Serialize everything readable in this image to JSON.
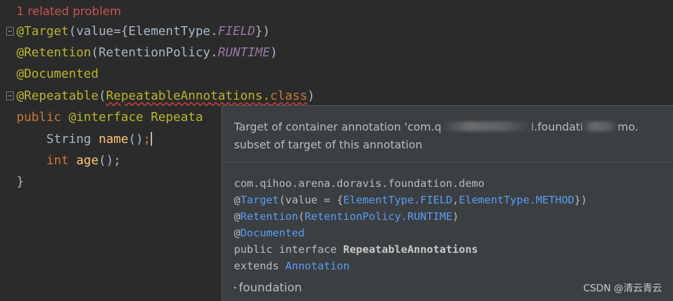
{
  "editor": {
    "problem_hint": "1 related problem",
    "lines": {
      "l1": {
        "annotation": "@Target",
        "open": "(value={ElementType.",
        "constant": "FIELD",
        "close": "})"
      },
      "l2": {
        "annotation": "@Retention",
        "open": "(RetentionPolicy.",
        "constant": "RUNTIME",
        "close": ")"
      },
      "l3": {
        "annotation": "@Documented"
      },
      "l4": {
        "annotation": "@Repeatable",
        "open": "(",
        "arg": "RepeatableAnnotations",
        "dot": ".",
        "keyword": "class",
        "close": ")"
      },
      "l5": {
        "keyword": "public",
        "annotation_kw": "@interface",
        "name": "Repeata"
      },
      "l6": {
        "type": "String",
        "method": "name",
        "parens": "()",
        "semicolon": ";"
      },
      "l7": {
        "keyword": "int",
        "method": "age",
        "parens": "();"
      },
      "l8": {
        "brace": "}"
      }
    }
  },
  "popup": {
    "message_start": "Target of container annotation 'com.q",
    "message_mid": "i.foundati",
    "message_end": "mo.",
    "message_line2": "subset of target of this annotation",
    "doc": {
      "package": "com.qihoo.arena.doravis.foundation.demo",
      "target_at": "@",
      "target_name": "Target",
      "target_open": "(value = {",
      "target_v1": "ElementType.FIELD",
      "target_comma": ",",
      "target_v2": "ElementType.METHOD",
      "target_close": "})",
      "retention_at": "@",
      "retention_name": "Retention",
      "retention_open": "(",
      "retention_value": "RetentionPolicy.RUNTIME",
      "retention_close": ")",
      "documented_at": "@",
      "documented_name": "Documented",
      "decl_prefix": "public interface ",
      "decl_name": "RepeatableAnnotations",
      "extends_kw": "extends ",
      "extends_name": "Annotation"
    },
    "footer": "foundation"
  },
  "watermark": "CSDN @清云青云"
}
